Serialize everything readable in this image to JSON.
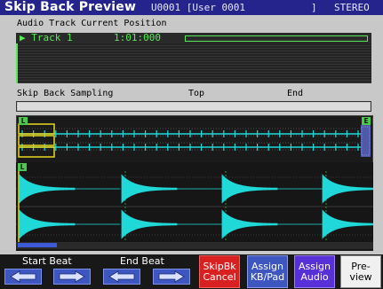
{
  "titlebar": {
    "title": "Skip Back Preview",
    "sample_info": "U0001 [User 0001",
    "bracket_close": "]",
    "channel_mode": "STEREO"
  },
  "track_section": {
    "heading": "Audio Track Current Position",
    "track_name": "▶ Track 1",
    "position": "1:01:000"
  },
  "sampling_section": {
    "heading": "Skip Back Sampling",
    "top_label": "Top",
    "end_label": "End"
  },
  "overview": {
    "left_marker": "L",
    "right_marker": "E"
  },
  "detail": {
    "marker": "L"
  },
  "function_bar": {
    "start_beat_label": "Start Beat",
    "end_beat_label": "End Beat",
    "skipbk_cancel": [
      "SkipBk",
      "Cancel"
    ],
    "assign_kbpad": [
      "Assign",
      "KB/Pad"
    ],
    "assign_audio": [
      "Assign",
      "Audio"
    ],
    "preview": [
      "Pre-",
      "view"
    ]
  },
  "colors": {
    "title_bg": "#24248c",
    "waveform": "#20d8d8",
    "track_text": "#58e858",
    "marker_yellow": "#e8d820",
    "cancel_red": "#d82020",
    "assign_blue": "#3e56c0",
    "assign_audio_purple": "#5830d8",
    "preview_white": "#f0f0f0"
  }
}
